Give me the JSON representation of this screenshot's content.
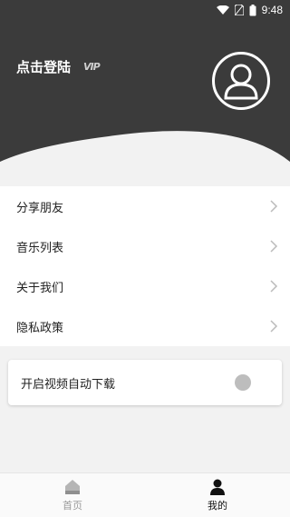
{
  "status": {
    "time": "9:48"
  },
  "profile": {
    "login_text": "点击登陆",
    "vip_badge": "VIP"
  },
  "menu": {
    "items": [
      {
        "label": "分享朋友"
      },
      {
        "label": "音乐列表"
      },
      {
        "label": "关于我们"
      },
      {
        "label": "隐私政策"
      }
    ]
  },
  "settings": {
    "auto_download_label": "开启视频自动下载",
    "auto_download_enabled": false
  },
  "tabs": [
    {
      "label": "首页",
      "icon": "home-icon",
      "active": false
    },
    {
      "label": "我的",
      "icon": "user-icon",
      "active": true
    }
  ]
}
